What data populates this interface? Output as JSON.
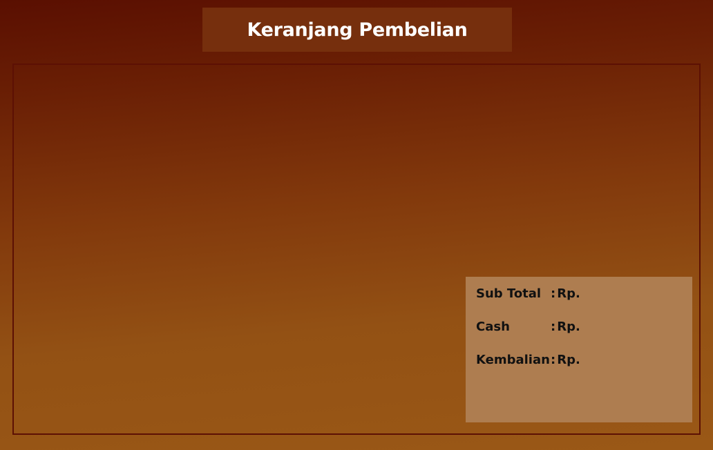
{
  "header": {
    "title": "Keranjang Pembelian"
  },
  "summary": {
    "rows": [
      {
        "label": "Sub Total",
        "separator": ":",
        "value": "Rp."
      },
      {
        "label": "Cash",
        "separator": ":",
        "value": "Rp."
      },
      {
        "label": "Kembalian",
        "separator": ":",
        "value": "Rp."
      }
    ]
  },
  "colors": {
    "background_top": "#5a0f01",
    "background_bottom": "#9a5816",
    "title_box": "#762f0d",
    "panel_border": "#5c1004",
    "summary_box": "#ae7d50"
  }
}
